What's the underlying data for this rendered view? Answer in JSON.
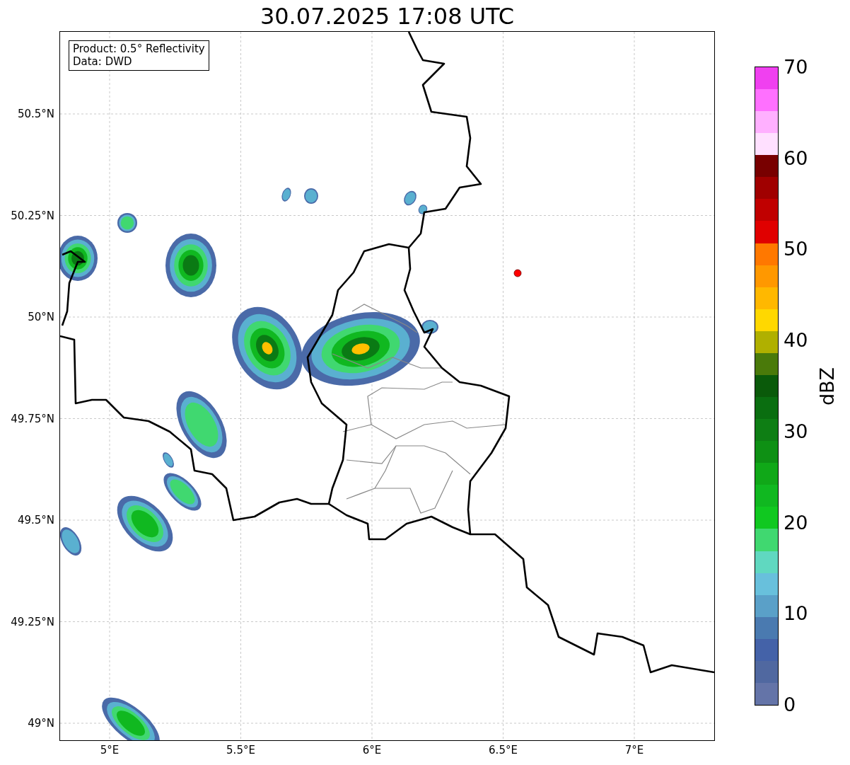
{
  "title": "30.07.2025 17:08 UTC",
  "info_box": {
    "lines": [
      "Product: 0.5° Reflectivity",
      "Data: DWD"
    ]
  },
  "map": {
    "x_ticks": [
      "5°E",
      "5.5°E",
      "6°E",
      "6.5°E",
      "7°E"
    ],
    "y_ticks": [
      "50.5°N",
      "50.25°N",
      "50°N",
      "49.75°N",
      "49.5°N",
      "49.25°N",
      "49°N"
    ]
  },
  "colorbar": {
    "label": "dBZ",
    "ticks": [
      "70",
      "60",
      "50",
      "40",
      "30",
      "20",
      "10",
      "0"
    ],
    "bins": [
      {
        "color": "#6474a8"
      },
      {
        "color": "#5068a0"
      },
      {
        "color": "#4462a8"
      },
      {
        "color": "#4a7ab0"
      },
      {
        "color": "#5aa0c8"
      },
      {
        "color": "#68c0dc"
      },
      {
        "color": "#60d8c0"
      },
      {
        "color": "#40d870"
      },
      {
        "color": "#10c820"
      },
      {
        "color": "#10b820"
      },
      {
        "color": "#10a818"
      },
      {
        "color": "#0e9014"
      },
      {
        "color": "#0e7e14"
      },
      {
        "color": "#0a6e10"
      },
      {
        "color": "#0a5a0a"
      },
      {
        "color": "#4a7a0a"
      },
      {
        "color": "#b0b000"
      },
      {
        "color": "#ffd800"
      },
      {
        "color": "#ffb800"
      },
      {
        "color": "#ff9800"
      },
      {
        "color": "#ff7800"
      },
      {
        "color": "#e00000"
      },
      {
        "color": "#c00000"
      },
      {
        "color": "#a00000"
      },
      {
        "color": "#780000"
      },
      {
        "color": "#ffe0ff"
      },
      {
        "color": "#ffb0ff"
      },
      {
        "color": "#ff70ff"
      },
      {
        "color": "#f040f0"
      }
    ]
  }
}
